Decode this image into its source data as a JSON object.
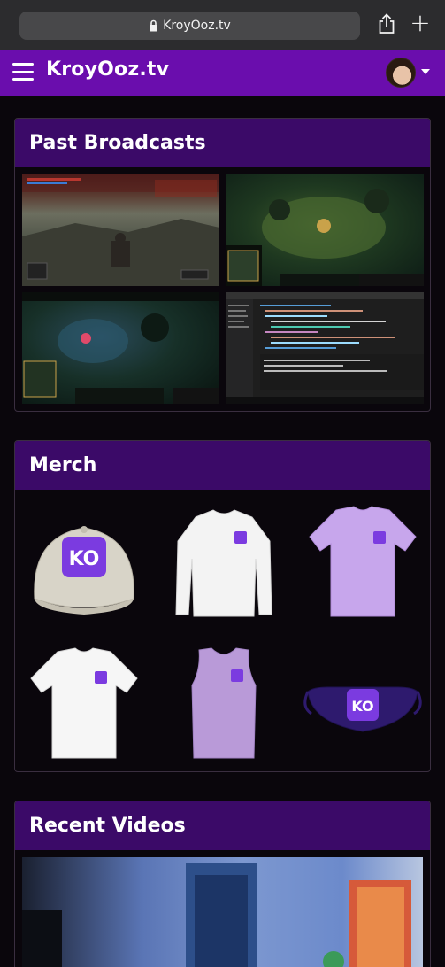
{
  "browser": {
    "url": "KroyOoz.tv"
  },
  "header": {
    "site_title": "KroyOoz.tv"
  },
  "sections": {
    "broadcasts": {
      "title": "Past Broadcasts"
    },
    "merch": {
      "title": "Merch"
    },
    "videos": {
      "title": "Recent Videos"
    }
  },
  "merch_items": [
    {
      "kind": "cap",
      "color": "#d8d4c8"
    },
    {
      "kind": "long-sleeve",
      "color": "#f3f3f3"
    },
    {
      "kind": "t-shirt",
      "color": "#c7a6ec"
    },
    {
      "kind": "t-shirt",
      "color": "#f6f6f6"
    },
    {
      "kind": "tank-top",
      "color": "#b99ad8"
    },
    {
      "kind": "face-mask",
      "color": "#2e1a6e"
    }
  ],
  "colors": {
    "brand_purple": "#6a0dad",
    "section_header": "#3b0a68",
    "logo_purple": "#7b3be0"
  }
}
